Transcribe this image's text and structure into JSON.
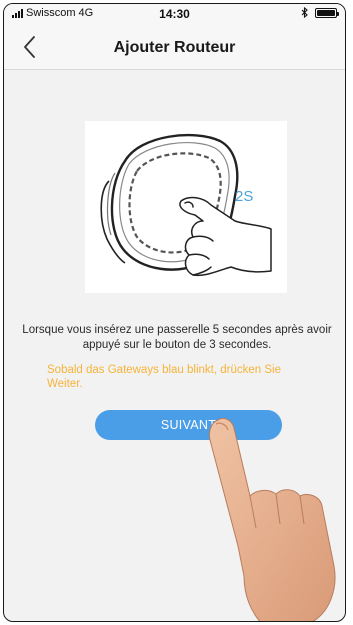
{
  "status_bar": {
    "carrier": "Swisscom",
    "network": "4G",
    "time": "14:30",
    "bluetooth_icon": "bluetooth-icon",
    "battery_level": 1.0
  },
  "navbar": {
    "title": "Ajouter Routeur",
    "back_icon": "chevron-left-icon"
  },
  "illustration": {
    "timer_label": "2S"
  },
  "content": {
    "description": "Lorsque vous insérez une passerelle 5 secondes après avoir appuyé sur le bouton de 3 secondes.",
    "hint": "Sobald das Gateways blau blinkt, drücken Sie Weiter.",
    "hint_color": "#f5b43a"
  },
  "actions": {
    "next_label": "SUIVANT",
    "button_color": "#4a9ee8"
  }
}
